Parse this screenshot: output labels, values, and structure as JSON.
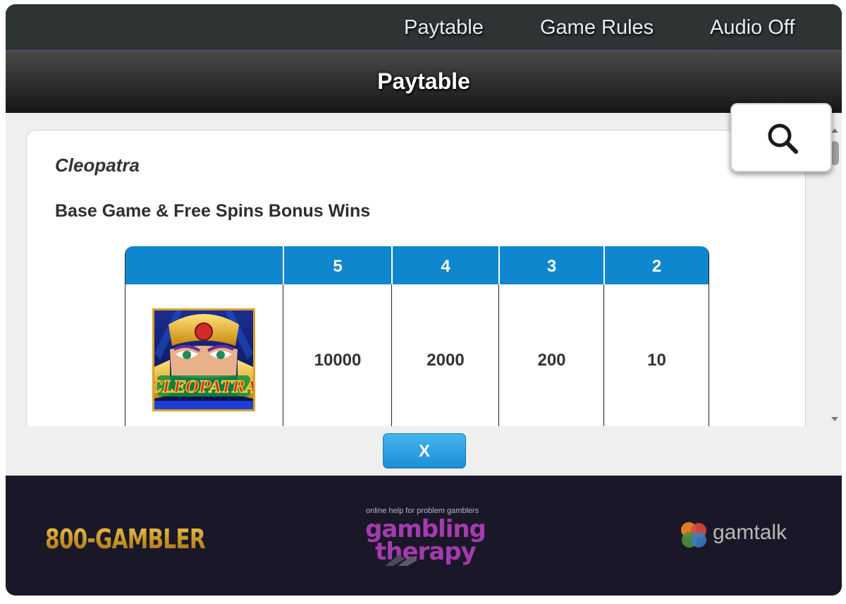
{
  "topnav": {
    "paytable_label": "Paytable",
    "rules_label": "Game Rules",
    "audio_label": "Audio Off"
  },
  "header": {
    "title": "Paytable"
  },
  "card": {
    "game_name": "Cleopatra",
    "section_title": "Base Game & Free Spins Bonus Wins"
  },
  "paytable": {
    "columns": [
      "5",
      "4",
      "3",
      "2"
    ],
    "rows": [
      {
        "symbol_label": "CLEOPATRA",
        "values": [
          "10000",
          "2000",
          "200",
          "10"
        ]
      }
    ]
  },
  "close_button": {
    "label": "X"
  },
  "footer": {
    "hotline": "800-GAMBLER",
    "gt_tagline": "online help for problem gamblers",
    "gt_line1": "gambling",
    "gt_line2": "therapy",
    "gamtalk": "gamtalk"
  },
  "icons": {
    "search": "search-icon",
    "scroll_up": "chevron-up-icon",
    "scroll_down": "chevron-down-icon"
  },
  "colors": {
    "accent_blue": "#0f87cf",
    "footer_bg": "#1a1828",
    "gt_purple": "#a43bb0",
    "hotline_gold": "#c7931a"
  }
}
